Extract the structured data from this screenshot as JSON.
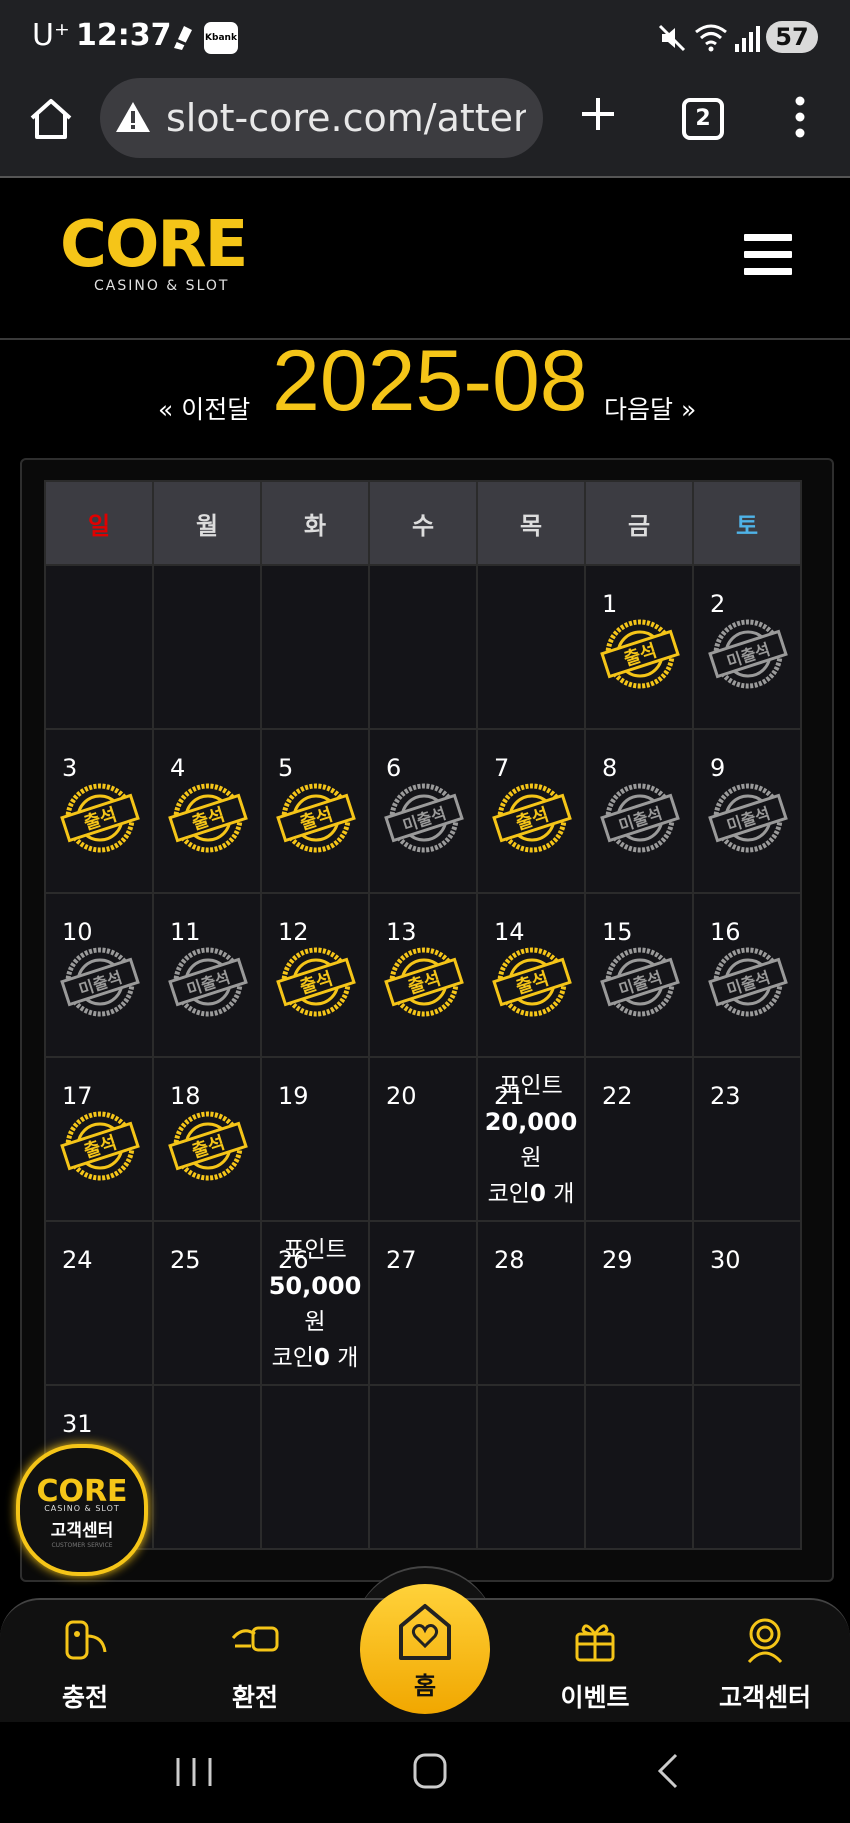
{
  "status_bar": {
    "carrier": "U⁺",
    "time": "12:37",
    "app_badge": "Kbank",
    "battery": "57"
  },
  "browser": {
    "url": "slot-core.com/attendance",
    "tab_count": "2"
  },
  "header": {
    "logo_text": "CORE",
    "logo_sub": "CASINO & SLOT"
  },
  "calendar": {
    "prev_label": "« 이전달",
    "title": "2025-08",
    "next_label": "다음달 »",
    "weekdays": [
      "일",
      "월",
      "화",
      "수",
      "목",
      "금",
      "토"
    ],
    "stamp_attended": "출석",
    "stamp_absent": "미출석",
    "days": {
      "1": "1",
      "2": "2",
      "3": "3",
      "4": "4",
      "5": "5",
      "6": "6",
      "7": "7",
      "8": "8",
      "9": "9",
      "10": "10",
      "11": "11",
      "12": "12",
      "13": "13",
      "14": "14",
      "15": "15",
      "16": "16",
      "17": "17",
      "18": "18",
      "19": "19",
      "20": "20",
      "21": "21",
      "22": "22",
      "23": "23",
      "24": "24",
      "25": "25",
      "26": "26",
      "27": "27",
      "28": "28",
      "29": "29",
      "30": "30",
      "31": "31"
    },
    "attended_days": [
      1,
      3,
      4,
      5,
      7,
      12,
      13,
      14,
      17,
      18
    ],
    "absent_days": [
      2,
      6,
      8,
      9,
      10,
      11,
      15,
      16
    ],
    "rewards": {
      "21": {
        "label": "포인트",
        "amount": "20,000",
        "unit": "원",
        "coin_prefix": "코인",
        "coin_amount": "0",
        "coin_unit": " 개"
      },
      "26": {
        "label": "포인트",
        "amount": "50,000",
        "unit": "원",
        "coin_prefix": "코인",
        "coin_amount": "0",
        "coin_unit": " 개"
      }
    }
  },
  "floating_cs": {
    "logo": "CORE",
    "sub": "CASINO & SLOT",
    "label": "고객센터",
    "tag": "CUSTOMER SERVICE"
  },
  "bottom_nav": {
    "charge": "충전",
    "exchange": "환전",
    "home": "홈",
    "event": "이벤트",
    "support": "고객센터"
  },
  "colors": {
    "accent": "#f5c518",
    "sunday": "#e00000",
    "saturday": "#4fb3e8"
  }
}
